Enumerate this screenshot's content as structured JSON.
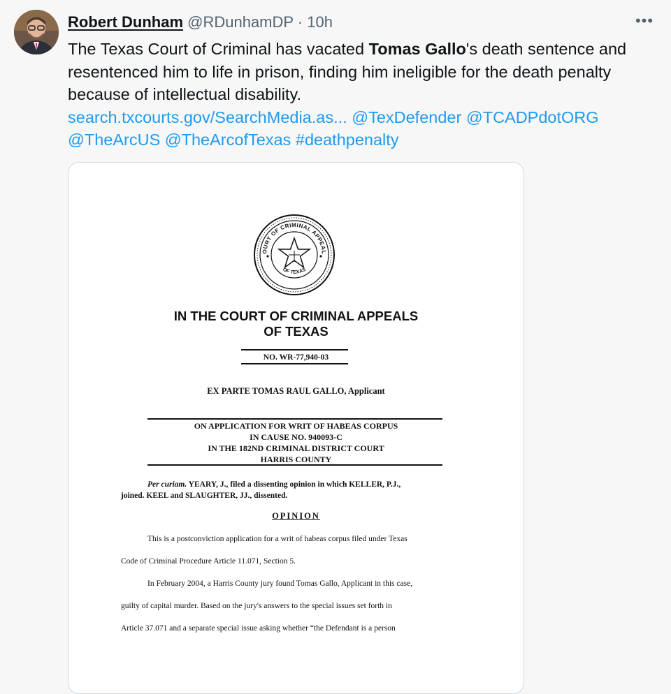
{
  "tweet": {
    "author_name": "Robert Dunham",
    "handle": "@RDunhamDP",
    "separator": "·",
    "time": "10h",
    "more": "•••",
    "text_before": "The Texas Court of Criminal has vacated ",
    "text_bold": "Tomas Gallo",
    "text_after": "'s death sentence and resentenced him to life in prison, finding him ineligible for the death penalty because of intellectual disability.",
    "links": {
      "url": "search.txcourts.gov/SearchMedia.as...",
      "mention1": "@TexDefender",
      "mention2": "@TCADPdotORG",
      "mention3": "@TheArcUS",
      "mention4": "@TheArcofTexas",
      "hashtag": "#deathpenalty"
    }
  },
  "document": {
    "seal": {
      "top_text": "COURT OF CRIMINAL APPEALS",
      "bottom_text": "OF TEXAS"
    },
    "title_line1": "IN THE COURT OF CRIMINAL APPEALS",
    "title_line2": "OF TEXAS",
    "case_no": "NO. WR-77,940-03",
    "party": "EX PARTE TOMAS RAUL GALLO, Applicant",
    "app_line1": "ON APPLICATION FOR WRIT OF HABEAS CORPUS",
    "app_line2": "IN CAUSE NO. 940093-C",
    "app_line3": "IN THE 182ND CRIMINAL DISTRICT COURT",
    "app_line4": "HARRIS COUNTY",
    "per_curiam_italic": "Per curiam.",
    "per_curiam_rest1": " YEARY, J., filed a dissenting opinion in which KELLER, P.J.,",
    "per_curiam_rest2": "joined. KEEL and SLAUGHTER, JJ., dissented.",
    "opinion_heading": "OPINION",
    "p1_line1": "This is a postconviction application for a writ of habeas corpus filed under Texas",
    "p1_line2": "Code of Criminal Procedure Article 11.071, Section 5.",
    "p2_line1": "In February 2004, a Harris County jury found Tomas Gallo, Applicant in this case,",
    "p2_line2": "guilty of capital murder. Based on the jury's answers to the special issues set forth in",
    "p2_line3": "Article 37.071 and a separate special issue asking whether “the Defendant is a person"
  }
}
